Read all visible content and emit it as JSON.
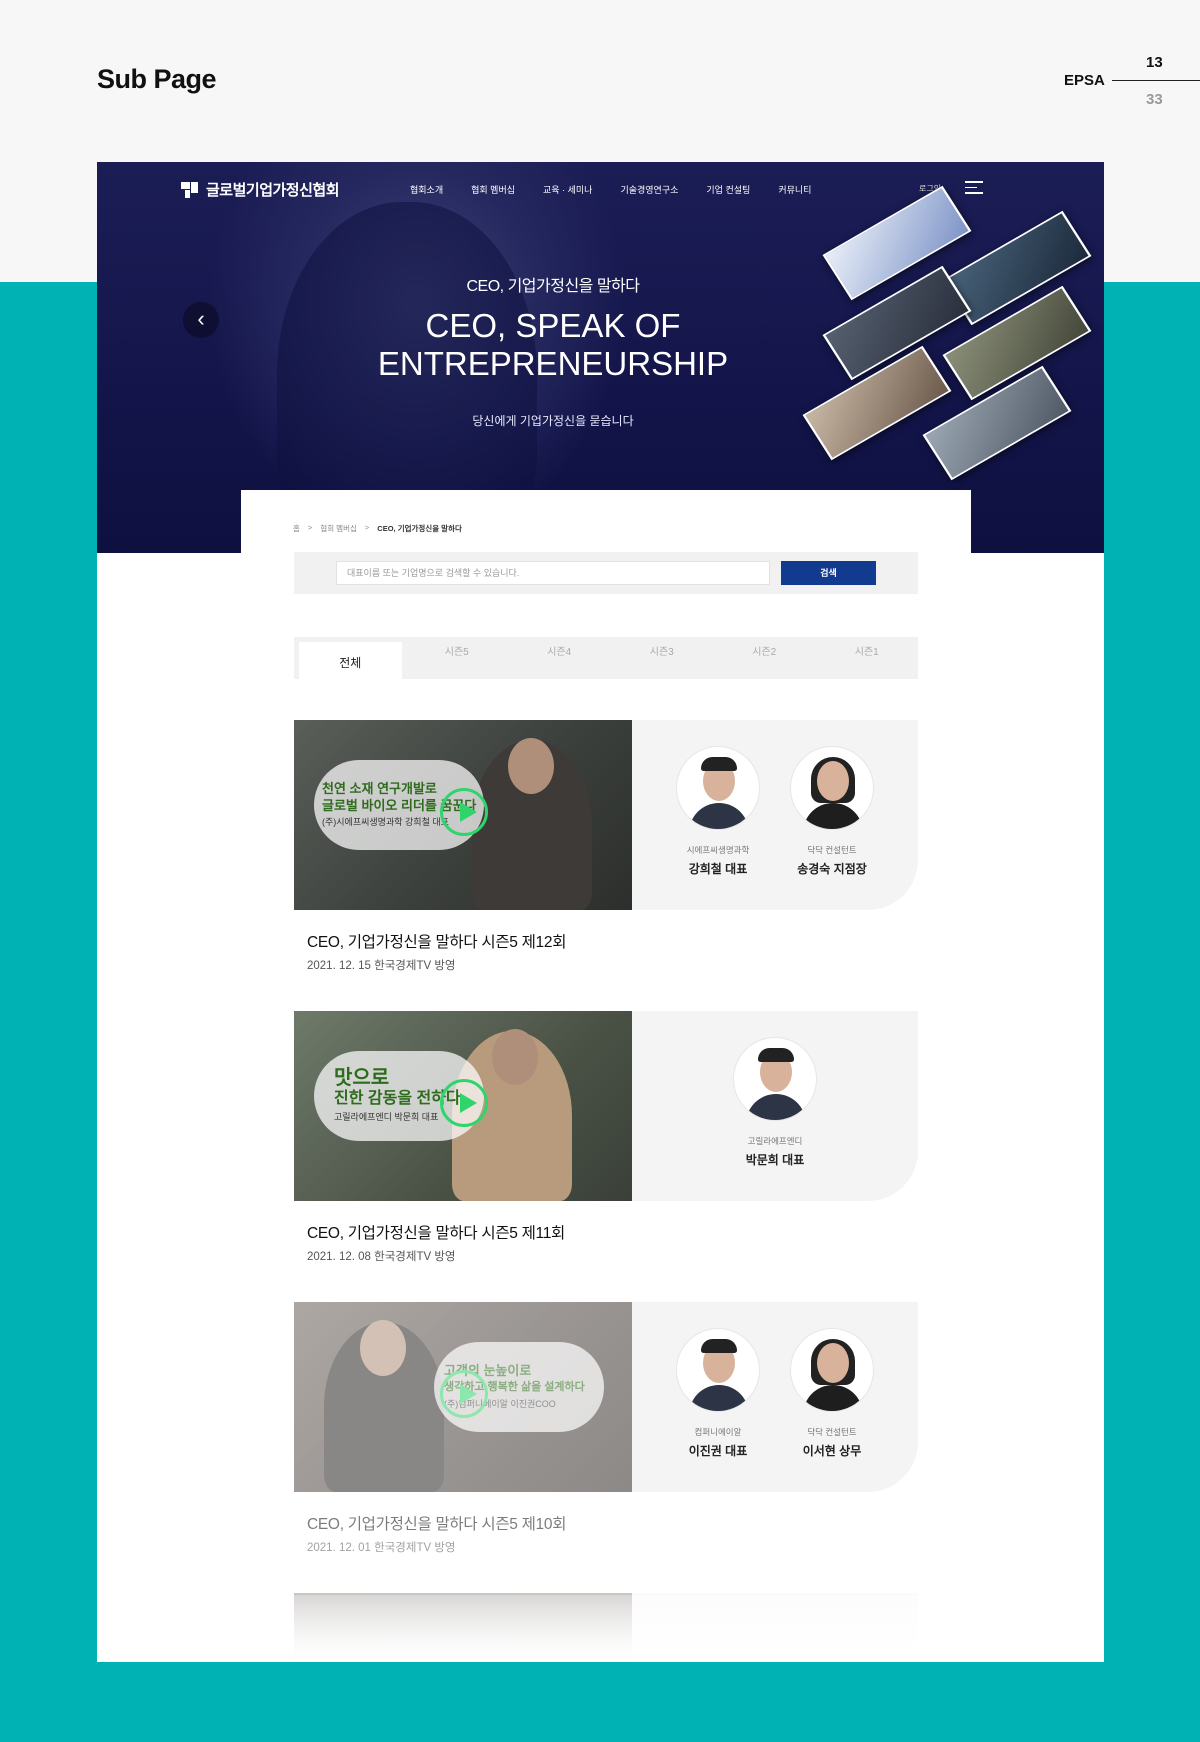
{
  "presentation": {
    "title": "Sub Page",
    "brand": "EPSA",
    "page": "13",
    "total": "33"
  },
  "header": {
    "logo_text": "글로벌기업가정신협회",
    "nav": [
      "협회소개",
      "협회 멤버십",
      "교육 · 세미나",
      "기술경영연구소",
      "기업 컨설팅",
      "커뮤니티"
    ],
    "login": "로그인"
  },
  "hero": {
    "subtitle": "CEO, 기업가정신을 말하다",
    "title_line1": "CEO, SPEAK OF",
    "title_line2": "ENTREPRENEURSHIP",
    "description": "당신에게 기업가정신을 묻습니다",
    "prev": "‹",
    "next": "›"
  },
  "breadcrumb": {
    "home": "홈",
    "level1": "협회 멤버십",
    "current": "CEO, 기업가정신을 말하다"
  },
  "search": {
    "placeholder": "대표이름 또는 기업명으로 검색할 수 있습니다.",
    "button": "검색"
  },
  "tabs": [
    "전체",
    "시즌5",
    "시즌4",
    "시즌3",
    "시즌2",
    "시즌1"
  ],
  "episodes": [
    {
      "title": "CEO, 기업가정신을 말하다 시즌5 제12회",
      "date": "2021. 12. 15 한국경제TV 방영",
      "thumb_caption_1": "천연 소재 연구개발로",
      "thumb_caption_2": "글로벌 바이오 리더를 꿈꾼다",
      "thumb_caption_3": "(주)시에프씨생명과학 강희철 대표",
      "people": [
        {
          "company": "시에프씨생명과학",
          "name": "강희철 대표"
        },
        {
          "company": "닥닥 컨설턴트",
          "name": "송경숙 지점장"
        }
      ]
    },
    {
      "title": "CEO, 기업가정신을 말하다 시즌5 제11회",
      "date": "2021. 12. 08 한국경제TV 방영",
      "thumb_caption_1": "맛으로",
      "thumb_caption_2": "진한 감동을 전하다",
      "thumb_caption_3": "고릴라에프엔디 박문희 대표",
      "people": [
        {
          "company": "고릴라에프엔디",
          "name": "박문희 대표"
        }
      ]
    },
    {
      "title": "CEO, 기업가정신을 말하다 시즌5 제10회",
      "date": "2021. 12. 01 한국경제TV 방영",
      "thumb_caption_1": "고객의 눈높이로",
      "thumb_caption_2": "생각하고 행복한 삶을 설계하다",
      "thumb_caption_3": "(주)컴퍼니에이알 이진권COO",
      "people": [
        {
          "company": "컴퍼니에이알",
          "name": "이진권 대표"
        },
        {
          "company": "닥닥 컨설턴트",
          "name": "이서현 상무"
        }
      ]
    }
  ],
  "colors": {
    "background_accent": "#00b2b4",
    "hero_navy": "#13154a",
    "search_button": "#123a8f",
    "play_icon": "#2fd56b"
  }
}
